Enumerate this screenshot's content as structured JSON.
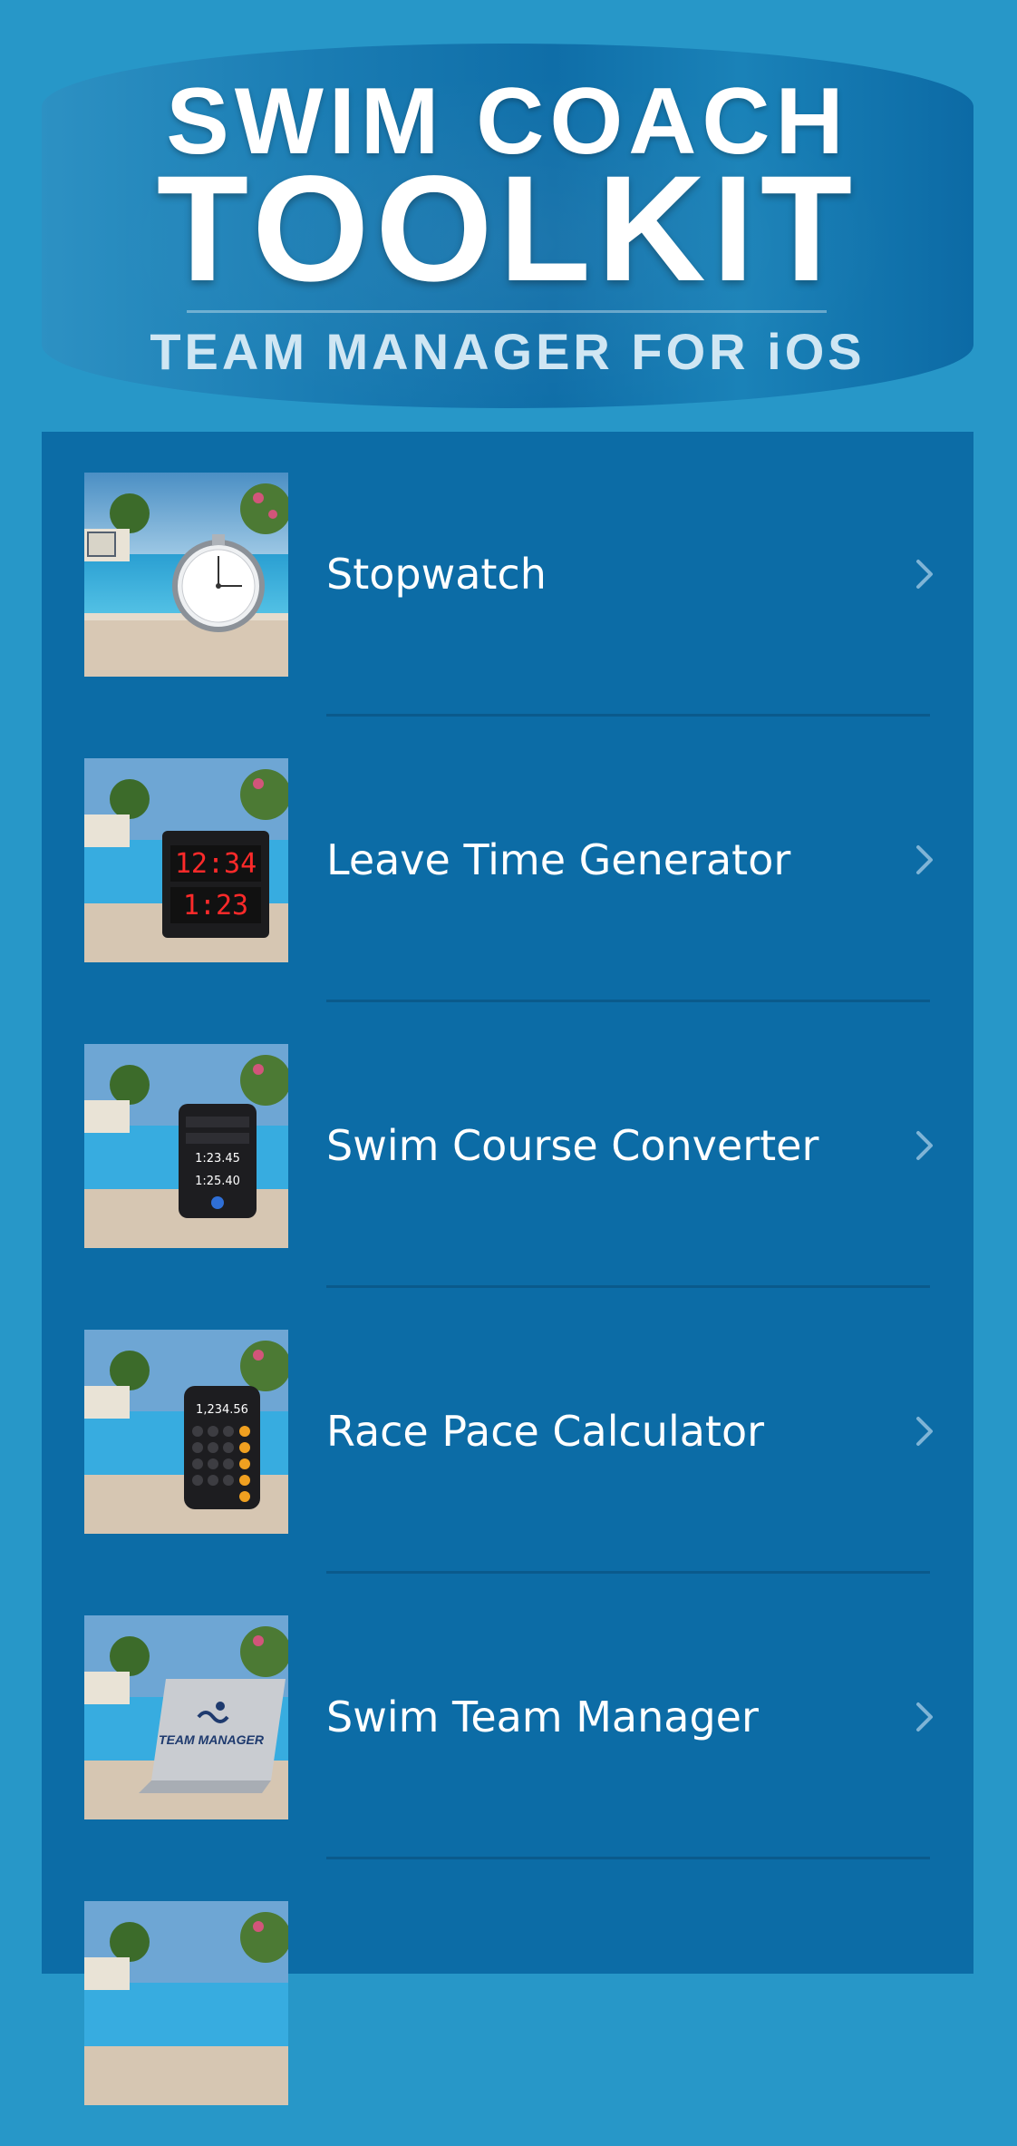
{
  "header": {
    "title_line_1": "SWIM COACH",
    "title_line_2": "TOOLKIT",
    "subtitle": "TEAM MANAGER FOR iOS"
  },
  "menu": {
    "items": [
      {
        "label": "Stopwatch",
        "thumbnail": "stopwatch-by-pool",
        "chevron": "chevron-right-icon"
      },
      {
        "label": "Leave Time Generator",
        "thumbnail": "pace-clock-by-pool",
        "chevron": "chevron-right-icon"
      },
      {
        "label": "Swim Course Converter",
        "thumbnail": "converter-device-by-pool",
        "chevron": "chevron-right-icon"
      },
      {
        "label": "Race Pace Calculator",
        "thumbnail": "calculator-by-pool",
        "chevron": "chevron-right-icon"
      },
      {
        "label": "Swim Team Manager",
        "thumbnail": "laptop-by-pool",
        "chevron": "chevron-right-icon"
      },
      {
        "label": "",
        "thumbnail": "pool-scene",
        "chevron": ""
      }
    ],
    "thumbnail_text": {
      "clock_top": "12:34",
      "clock_bottom": "1:23",
      "converter_value_1": "1:23.45",
      "converter_value_2": "1:25.40",
      "calculator_display": "1,234.56",
      "laptop_text": "TEAM MANAGER"
    }
  },
  "colors": {
    "background": "#2797c8",
    "panel": "#0c6ca6",
    "separator": "#0a5a8c",
    "text": "#ffffff",
    "chevron": "#7fb4d6"
  }
}
